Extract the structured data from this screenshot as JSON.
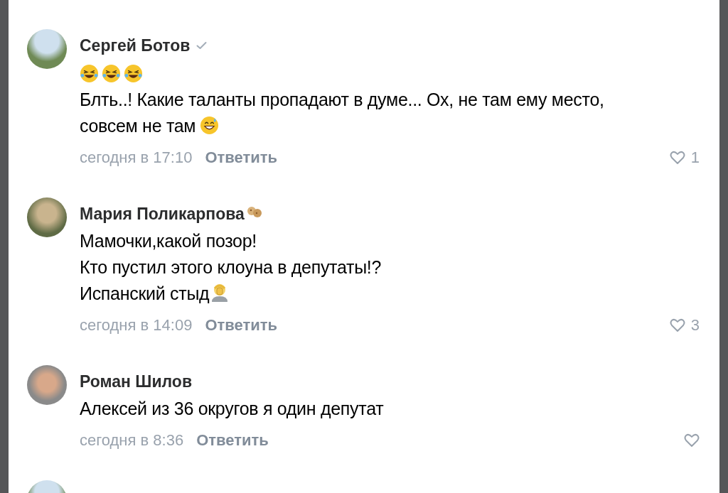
{
  "comments": [
    {
      "author": "Сергей Ботов",
      "verified": true,
      "text": "Блть..! Какие таланты пропадают в думе... Ох, не там ему место, совсем не там",
      "time": "сегодня в 17:10",
      "reply": "Ответить",
      "likes": "1"
    },
    {
      "author": "Мария Поликарпова",
      "verified": false,
      "text": "Мамочки,какой позор!\nКто пустил этого клоуна в депутаты!?\nИспанский стыд",
      "time": "сегодня в 14:09",
      "reply": "Ответить",
      "likes": "3"
    },
    {
      "author": "Роман Шилов",
      "verified": false,
      "text": "Алексей из 36 округов я один депутат",
      "time": "сегодня в 8:36",
      "reply": "Ответить"
    }
  ]
}
